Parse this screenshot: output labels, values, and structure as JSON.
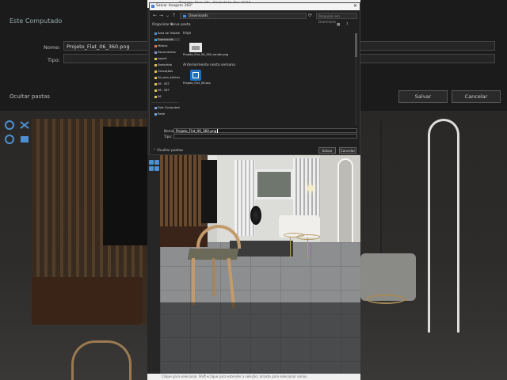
{
  "background": {
    "sidebar_title": "Este Computado",
    "name_label": "Nome:",
    "name_value": "Projeto_Flat_06_360.png",
    "type_label": "Tipo:",
    "hide_folders": "Ocultar pastas",
    "save_button": "Salvar",
    "cancel_button": "Cancelar"
  },
  "app": {
    "title": "Projeto_Flat_06 - SketchUp Pro 2023",
    "status": "Clique para selecionar. Shift+clique para estender a seleção; arraste para selecionar vários."
  },
  "dialog": {
    "title": "Salvar Imagem 360°",
    "close": "✕",
    "address": "Downloads",
    "search_placeholder": "Pesquisar em Downloads",
    "toolbar": {
      "organize": "Organizar ▾",
      "new_folder": "Nova pasta"
    },
    "sidebar": [
      {
        "label": "Área de Trabalho",
        "color": "#4a90d9"
      },
      {
        "label": "Downloads",
        "color": "#3aa0e0"
      },
      {
        "label": "Música",
        "color": "#e07a4a"
      },
      {
        "label": "Documentos",
        "color": "#7a9ad0"
      },
      {
        "label": "export",
        "color": "#e0c050"
      },
      {
        "label": "Sketchfab",
        "color": "#e0c050"
      },
      {
        "label": "Gravações",
        "color": "#e0c050"
      },
      {
        "label": "3d_sem_kitchen",
        "color": "#e0c050"
      },
      {
        "label": "06 - SET",
        "color": "#e0c050"
      },
      {
        "label": "06 - SET",
        "color": "#e0c050"
      },
      {
        "label": "06",
        "color": "#e0c050"
      },
      {
        "label": "Este Computador",
        "color": "#6fa8e0"
      },
      {
        "label": "Rede",
        "color": "#6fa8e0"
      }
    ],
    "groups": {
      "today": "Hoje",
      "recent": "Anteriormente nesta semana"
    },
    "files": {
      "f1": "Projeto_Flat_06_360_render.png",
      "f2": "Projeto_Flat_06.skp"
    },
    "name_label": "Nome:",
    "name_value": "Projeto_Flat_06_360.png",
    "type_label": "Tipo:",
    "type_value": "",
    "hide_folders": "Ocultar pastas",
    "save_button": "Salvar",
    "cancel_button": "Cancelar"
  },
  "colors": {
    "accent": "#3d8ee0",
    "dialog_bg": "#202020",
    "wood": "#c39a6a"
  }
}
